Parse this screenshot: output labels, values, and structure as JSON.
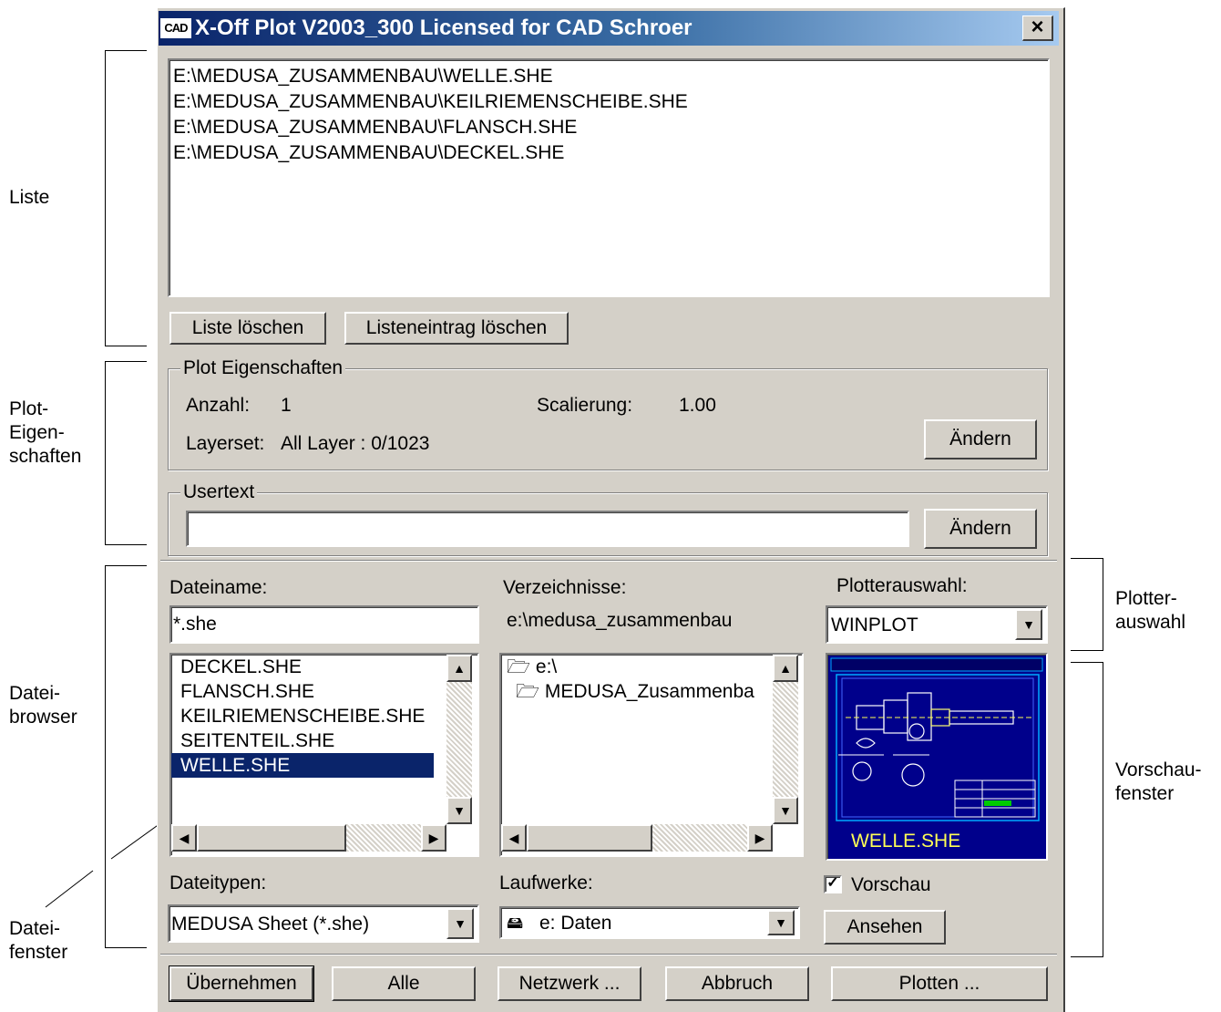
{
  "window": {
    "title": "X-Off Plot V2003_300 Licensed for CAD Schroer",
    "icon_text": "CAD",
    "close_label": "×"
  },
  "annotations": {
    "liste": "Liste",
    "plot_eigenschaften": "Plot-\nEigen-\nschaften",
    "dateibrowser": "Datei-\nbrowser",
    "dateifenster": "Datei-\nfenster",
    "plotterauswahl": "Plotter-\nauswahl",
    "vorschaufenster": "Vorschau-\nfenster"
  },
  "plot_list": {
    "items": [
      "E:\\MEDUSA_ZUSAMMENBAU\\WELLE.SHE",
      "E:\\MEDUSA_ZUSAMMENBAU\\KEILRIEMENSCHEIBE.SHE",
      "E:\\MEDUSA_ZUSAMMENBAU\\FLANSCH.SHE",
      "E:\\MEDUSA_ZUSAMMENBAU\\DECKEL.SHE"
    ],
    "clear_button": "Liste löschen",
    "delete_entry_button": "Listeneintrag löschen"
  },
  "plot_properties": {
    "group_label": "Plot Eigenschaften",
    "anzahl_label": "Anzahl:",
    "anzahl_value": "1",
    "scaling_label": "Scalierung:",
    "scaling_value": "1.00",
    "layerset_label": "Layerset:",
    "layerset_value": "All Layer : 0/1023",
    "change_button": "Ändern"
  },
  "usertext": {
    "group_label": "Usertext",
    "value": "",
    "change_button": "Ändern"
  },
  "file_browser": {
    "filename_label": "Dateiname:",
    "filename_value": "*.she",
    "files": [
      "DECKEL.SHE",
      "FLANSCH.SHE",
      "KEILRIEMENSCHEIBE.SHE",
      "SEITENTEIL.SHE",
      "WELLE.SHE"
    ],
    "selected_file": "WELLE.SHE",
    "dirs_label": "Verzeichnisse:",
    "current_dir": "e:\\medusa_zusammenbau",
    "dirs": [
      "e:\\",
      "MEDUSA_Zusammenba"
    ],
    "filetypes_label": "Dateitypen:",
    "filetype_value": "MEDUSA Sheet (*.she)",
    "drives_label": "Laufwerke:",
    "drive_value": "e: Daten"
  },
  "plotter": {
    "label": "Plotterauswahl:",
    "value": "WINPLOT"
  },
  "preview": {
    "caption": "WELLE.SHE",
    "checkbox_label": "Vorschau",
    "checked": true,
    "view_button": "Ansehen"
  },
  "bottom_buttons": {
    "apply": "Übernehmen",
    "all": "Alle",
    "network": "Netzwerk ...",
    "cancel": "Abbruch",
    "plot": "Plotten ..."
  }
}
